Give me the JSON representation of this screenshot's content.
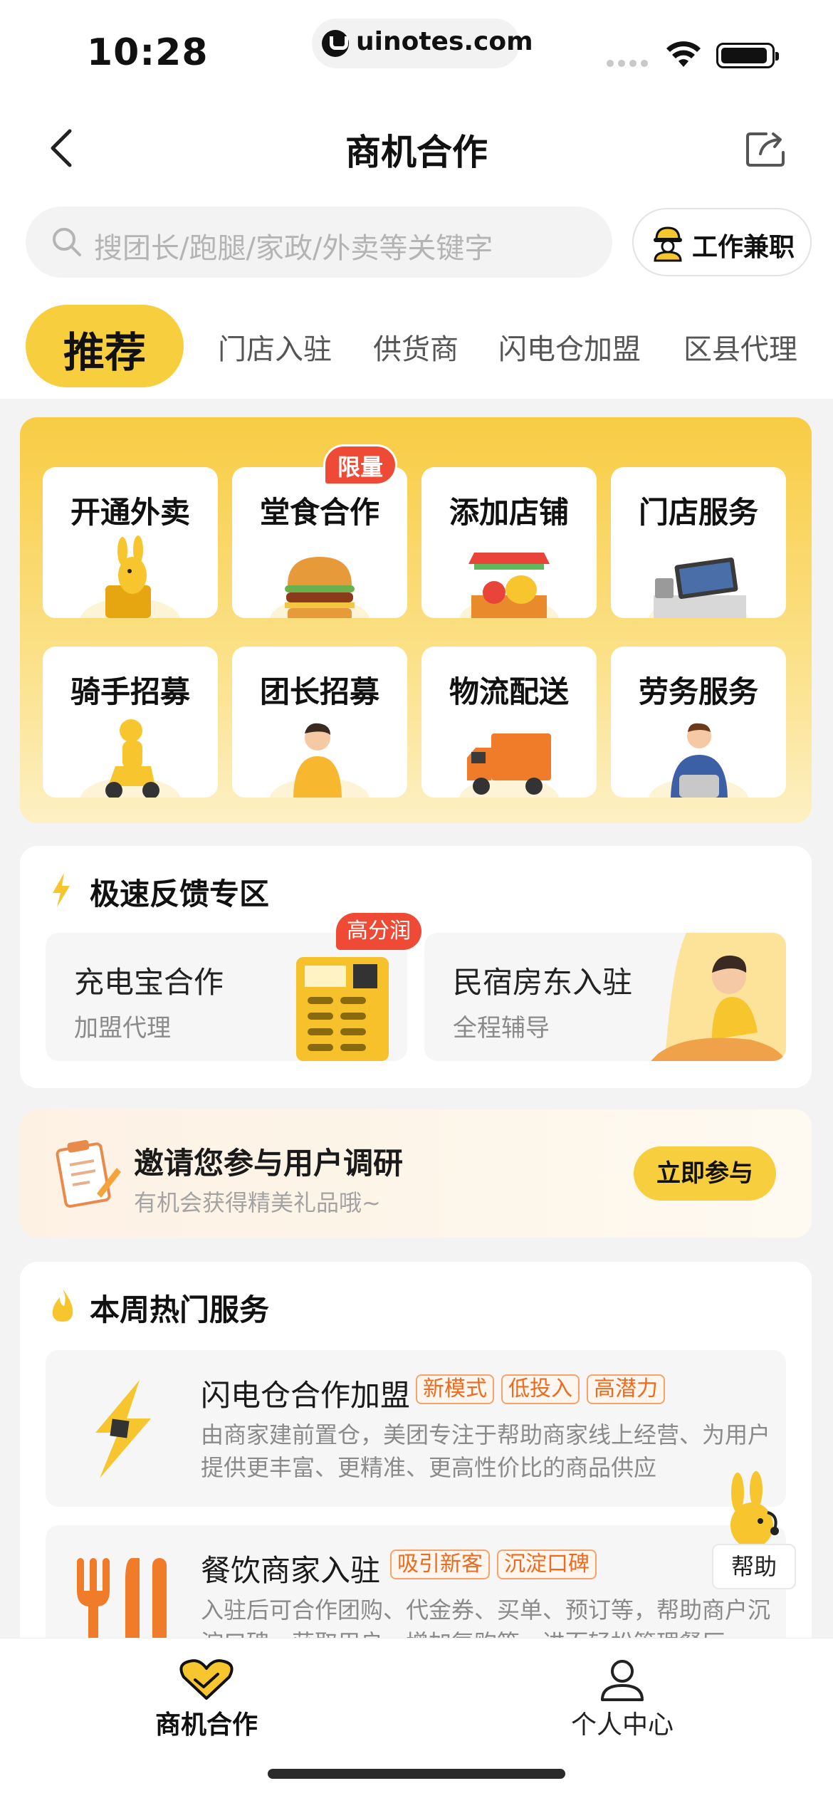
{
  "status_bar": {
    "time": "10:28",
    "url": "uinotes.com"
  },
  "header": {
    "title": "商机合作",
    "search_placeholder": "搜团长/跑腿/家政/外卖等关键字",
    "job_button_label": "工作兼职"
  },
  "tabs": {
    "active": "推荐",
    "items": [
      "门店入驻",
      "供货商",
      "闪电仓加盟",
      "区县代理"
    ]
  },
  "categories": [
    {
      "label": "开通外卖",
      "icon": "kangaroo-delivery-icon"
    },
    {
      "label": "堂食合作",
      "icon": "burger-icon",
      "badge": "限量"
    },
    {
      "label": "添加店铺",
      "icon": "fruit-stall-icon"
    },
    {
      "label": "门店服务",
      "icon": "pos-machine-icon"
    },
    {
      "label": "骑手招募",
      "icon": "rider-scooter-icon"
    },
    {
      "label": "团长招募",
      "icon": "leader-person-icon"
    },
    {
      "label": "物流配送",
      "icon": "truck-icon"
    },
    {
      "label": "劳务服务",
      "icon": "laptop-worker-icon"
    }
  ],
  "feedback": {
    "title": "极速反馈专区",
    "items": [
      {
        "title": "充电宝合作",
        "subtitle": "加盟代理",
        "badge": "高分润"
      },
      {
        "title": "民宿房东入驻",
        "subtitle": "全程辅导"
      }
    ]
  },
  "survey": {
    "title": "邀请您参与用户调研",
    "subtitle": "有机会获得精美礼品哦~",
    "button": "立即参与"
  },
  "hot_services": {
    "title": "本周热门服务",
    "items": [
      {
        "title": "闪电仓合作加盟",
        "tags": [
          "新模式",
          "低投入",
          "高潜力"
        ],
        "description": "由商家建前置仓，美团专注于帮助商家线上经营、为用户提供更丰富、更精准、更高性价比的商品供应"
      },
      {
        "title": "餐饮商家入驻",
        "tags": [
          "吸引新客",
          "沉淀口碑"
        ],
        "description": "入驻后可合作团购、代金券、买单、预订等，帮助商户沉淀口碑、获取用户、增加复购等，进而轻松管理餐厅"
      }
    ]
  },
  "help": {
    "label": "帮助"
  },
  "bottom_nav": [
    {
      "label": "商机合作",
      "icon": "heart-handshake-icon"
    },
    {
      "label": "个人中心",
      "icon": "person-icon"
    }
  ],
  "colors": {
    "brand_yellow": "#f7cf3e",
    "badge_red": "#ee4a35",
    "tag_orange": "#ee6a1e"
  }
}
